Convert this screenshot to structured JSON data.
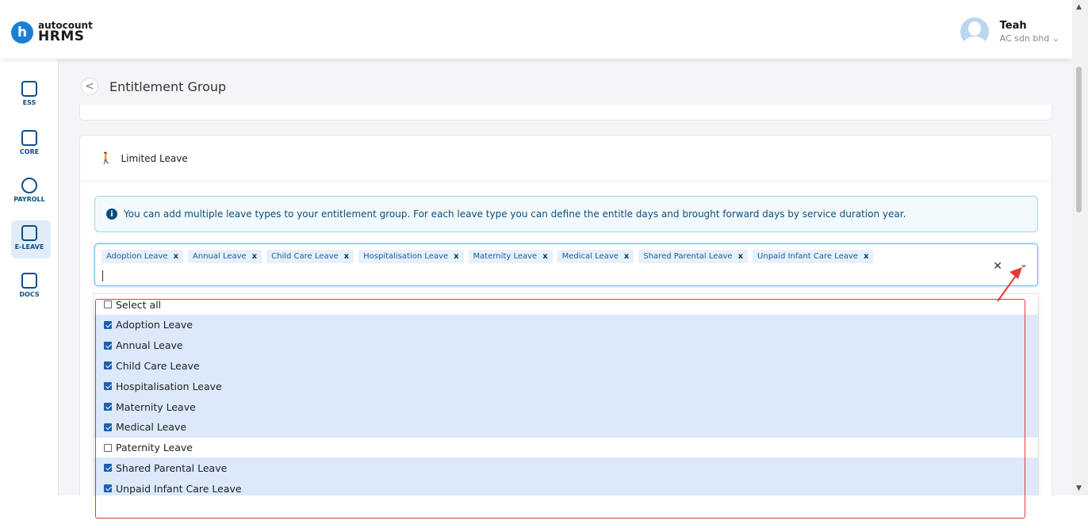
{
  "app": {
    "logo_top": "autocount",
    "logo_bottom": "HRMS",
    "logo_letter": "h"
  },
  "user": {
    "name": "Teah",
    "company": "AC sdn bhd ⌄"
  },
  "sidebar": {
    "items": [
      {
        "label": "ESS",
        "icon": "ess-icon"
      },
      {
        "label": "CORE",
        "icon": "core-icon"
      },
      {
        "label": "PAYROLL",
        "icon": "payroll-icon"
      },
      {
        "label": "E-LEAVE",
        "icon": "calendar-icon",
        "active": true
      },
      {
        "label": "DOCS",
        "icon": "docs-icon"
      }
    ]
  },
  "page": {
    "title": "Entitlement Group",
    "back_glyph": "<"
  },
  "section": {
    "title": "Limited Leave",
    "info_text": "You can add multiple leave types to your entitlement group. For each leave type you can define the entitle days and brought forward days by service duration year."
  },
  "select": {
    "tags": [
      "Adoption Leave",
      "Annual Leave",
      "Child Care Leave",
      "Hospitalisation Leave",
      "Maternity Leave",
      "Medical Leave",
      "Shared Parental Leave",
      "Unpaid Infant Care Leave"
    ],
    "tag_remove": "x",
    "clear_glyph": "✕",
    "chevron_glyph": "⌄"
  },
  "dropdown": {
    "options": [
      {
        "label": "Select all",
        "checked": false
      },
      {
        "label": "Adoption Leave",
        "checked": true
      },
      {
        "label": "Annual Leave",
        "checked": true
      },
      {
        "label": "Child Care Leave",
        "checked": true
      },
      {
        "label": "Hospitalisation Leave",
        "checked": true
      },
      {
        "label": "Maternity Leave",
        "checked": true
      },
      {
        "label": "Medical Leave",
        "checked": true
      },
      {
        "label": "Paternity Leave",
        "checked": false
      },
      {
        "label": "Shared Parental Leave",
        "checked": true
      },
      {
        "label": "Unpaid Infant Care Leave",
        "checked": true
      }
    ]
  },
  "colors": {
    "brand": "#1c7fd6",
    "annotation": "#e53935"
  }
}
